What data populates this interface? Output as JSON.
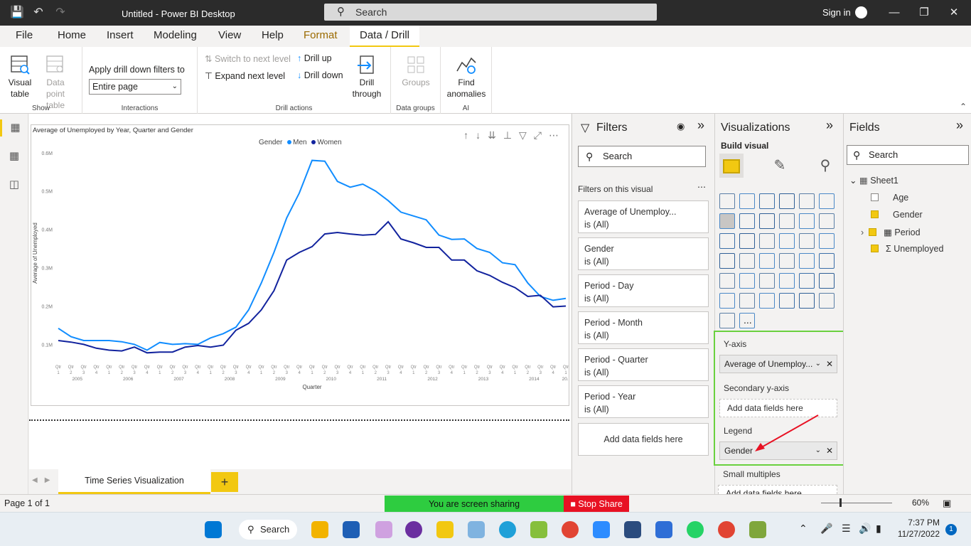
{
  "app": {
    "title": "Untitled - Power BI Desktop",
    "search_label": "Search",
    "sign_in": "Sign in"
  },
  "tabs": [
    "File",
    "Home",
    "Insert",
    "Modeling",
    "View",
    "Help",
    "Format",
    "Data / Drill"
  ],
  "ribbon": {
    "visual_table": "Visual table",
    "data_point_table": "Data point table",
    "show_label": "Show",
    "apply_drill_label": "Apply drill down filters to",
    "apply_drill_value": "Entire page",
    "interactions_label": "Interactions",
    "switch_next_level": "Switch to next level",
    "expand_next_level": "Expand next level",
    "drill_up": "Drill up",
    "drill_down": "Drill down",
    "drill_through": "Drill through",
    "drill_actions_label": "Drill actions",
    "groups": "Groups",
    "data_groups_label": "Data groups",
    "find_anomalies": "Find anomalies",
    "ai_label": "AI"
  },
  "visual": {
    "title": "Average of Unemployed by Year, Quarter and Gender",
    "legend_title": "Gender",
    "series_colors": {
      "Men": "#118dff",
      "Women": "#12239e"
    }
  },
  "chart_data": {
    "type": "line",
    "title": "Average of Unemployed by Year, Quarter and Gender",
    "xlabel": "Quarter",
    "ylabel": "Average of Unemployed",
    "ylim": [
      0.06,
      0.62
    ],
    "yticks": [
      "0.1M",
      "0.2M",
      "0.3M",
      "0.4M",
      "0.5M",
      "0.6M"
    ],
    "ytick_values": [
      0.1,
      0.2,
      0.3,
      0.4,
      0.5,
      0.6
    ],
    "quarter_labels": [
      "Qtr 1",
      "Qtr 2",
      "Qtr 3",
      "Qtr 4"
    ],
    "years": [
      "2005",
      "2006",
      "2007",
      "2008",
      "2009",
      "2010",
      "2011",
      "2012",
      "2013",
      "2014",
      "20.."
    ],
    "legend": "top-center",
    "series": [
      {
        "name": "Men",
        "color": "#118dff",
        "values": [
          0.142,
          0.12,
          0.11,
          0.11,
          0.11,
          0.107,
          0.1,
          0.085,
          0.105,
          0.1,
          0.102,
          0.1,
          0.117,
          0.128,
          0.145,
          0.19,
          0.26,
          0.34,
          0.43,
          0.495,
          0.58,
          0.578,
          0.525,
          0.51,
          0.518,
          0.5,
          0.475,
          0.445,
          0.435,
          0.425,
          0.385,
          0.374,
          0.375,
          0.35,
          0.34,
          0.313,
          0.308,
          0.26,
          0.225,
          0.215,
          0.22
        ]
      },
      {
        "name": "Women",
        "color": "#12239e",
        "values": [
          0.11,
          0.106,
          0.1,
          0.09,
          0.085,
          0.083,
          0.093,
          0.078,
          0.08,
          0.08,
          0.093,
          0.097,
          0.093,
          0.098,
          0.137,
          0.155,
          0.19,
          0.24,
          0.32,
          0.34,
          0.355,
          0.388,
          0.392,
          0.388,
          0.385,
          0.387,
          0.42,
          0.375,
          0.365,
          0.353,
          0.353,
          0.32,
          0.32,
          0.292,
          0.28,
          0.262,
          0.248,
          0.225,
          0.228,
          0.198,
          0.2
        ]
      }
    ]
  },
  "pages": {
    "tab_label": "Time Series Visualization",
    "add_label": "+",
    "page_indicator": "Page 1 of 1"
  },
  "filters": {
    "title": "Filters",
    "search": "Search",
    "section": "Filters on this visual",
    "cards": [
      {
        "name": "Average of Unemploy...",
        "state": "is (All)"
      },
      {
        "name": "Gender",
        "state": "is (All)"
      },
      {
        "name": "Period - Day",
        "state": "is (All)"
      },
      {
        "name": "Period - Month",
        "state": "is (All)"
      },
      {
        "name": "Period - Quarter",
        "state": "is (All)"
      },
      {
        "name": "Period - Year",
        "state": "is (All)"
      }
    ],
    "add": "Add data fields here"
  },
  "visualizations": {
    "title": "Visualizations",
    "build": "Build visual",
    "yaxis_label": "Y-axis",
    "yaxis_field": "Average of Unemploy...",
    "secondary_label": "Secondary y-axis",
    "secondary_placeholder": "Add data fields here",
    "legend_label": "Legend",
    "legend_field": "Gender",
    "small_multiples_label": "Small multiples",
    "small_multiples_placeholder": "Add data fields here",
    "more": "..."
  },
  "fields": {
    "title": "Fields",
    "search": "Search",
    "table": "Sheet1",
    "items": [
      {
        "name": "Age",
        "checked": false
      },
      {
        "name": "Gender",
        "checked": true
      },
      {
        "name": "Period",
        "checked": true
      },
      {
        "name": "Unemployed",
        "checked": true
      }
    ]
  },
  "status": {
    "sharing": "You are screen sharing",
    "stop_share": "Stop Share",
    "zoom": "60%"
  },
  "taskbar": {
    "search": "Search",
    "time": "7:37 PM",
    "date": "11/27/2022",
    "notifications": "1"
  }
}
